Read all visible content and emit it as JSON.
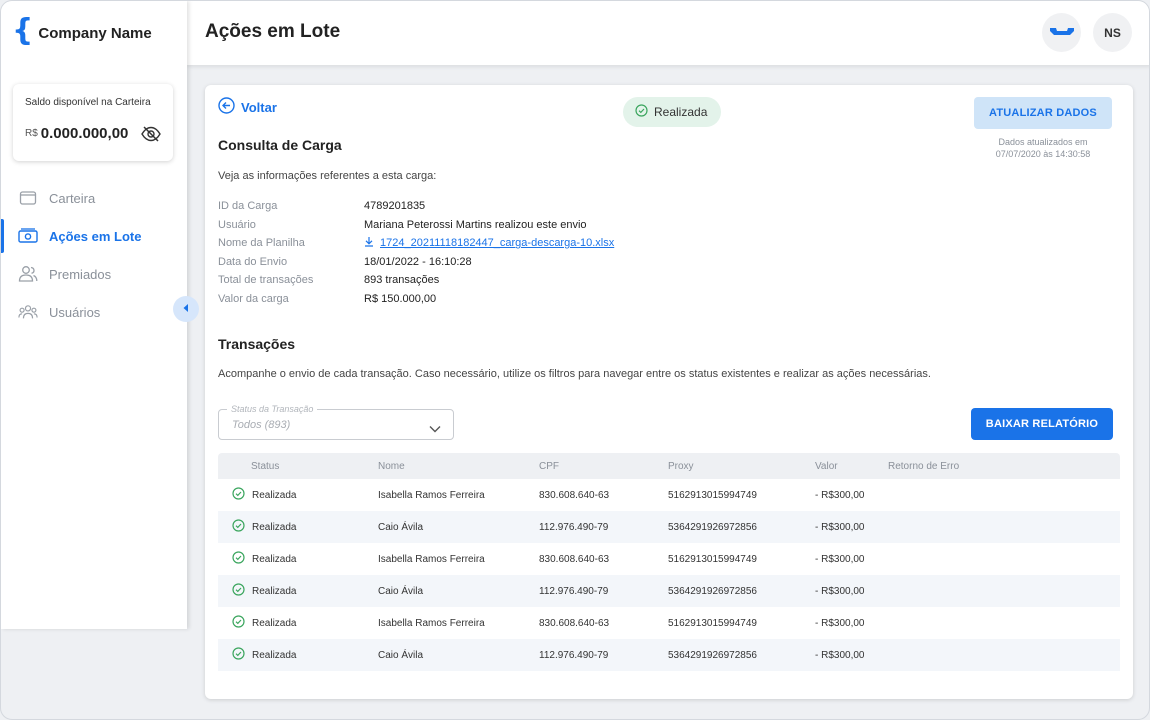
{
  "app": {
    "company_name": "Company Name"
  },
  "balance": {
    "label": "Saldo disponível na Carteira",
    "currency": "R$",
    "value": "0.000.000,00"
  },
  "sidebar": {
    "items": [
      {
        "label": "Carteira",
        "icon": "wallet-icon",
        "active": false
      },
      {
        "label": "Ações em Lote",
        "icon": "batch-money-icon",
        "active": true
      },
      {
        "label": "Premiados",
        "icon": "users-icon",
        "active": false
      },
      {
        "label": "Usuários",
        "icon": "group-icon",
        "active": false
      }
    ]
  },
  "header": {
    "title": "Ações em Lote",
    "avatar_initials": "NS"
  },
  "card": {
    "back_label": "Voltar",
    "status_label": "Realizada",
    "update_button": "ATUALIZAR DADOS",
    "updated_note_line1": "Dados atualizados em",
    "updated_note_line2": "07/07/2020 às 14:30:58",
    "title": "Consulta de Carga",
    "intro": "Veja as informações referentes a esta carga:",
    "info": [
      {
        "label": "ID da Carga",
        "value": "4789201835"
      },
      {
        "label": "Usuário",
        "value": "Mariana Peterossi Martins realizou este envio"
      },
      {
        "label": "Nome da Planilha",
        "value": "1724_20211118182447_carga-descarga-10.xlsx"
      },
      {
        "label": "Data do Envio",
        "value": "18/01/2022 - 16:10:28"
      },
      {
        "label": "Total de transações",
        "value": "893 transações"
      },
      {
        "label": "Valor da carga",
        "value": "R$ 150.000,00"
      }
    ],
    "transactions_title": "Transações",
    "transactions_desc": "Acompanhe o envio de cada transação. Caso necessário, utilize os filtros para navegar entre os status existentes e realizar as ações necessárias.",
    "filter": {
      "label": "Status da Transação",
      "value": "Todos (893)"
    },
    "report_button": "BAIXAR RELATÓRIO"
  },
  "table": {
    "columns": [
      "Status",
      "Nome",
      "CPF",
      "Proxy",
      "Valor",
      "Retorno de Erro"
    ],
    "rows": [
      [
        "Realizada",
        "Isabella Ramos Ferreira",
        "830.608.640-63",
        "5162913015994749",
        "- R$300,00",
        ""
      ],
      [
        "Realizada",
        "Caio Ávila",
        "112.976.490-79",
        "5364291926972856",
        "- R$300,00",
        ""
      ],
      [
        "Realizada",
        "Isabella Ramos Ferreira",
        "830.608.640-63",
        "5162913015994749",
        "- R$300,00",
        ""
      ],
      [
        "Realizada",
        "Caio Ávila",
        "112.976.490-79",
        "5364291926972856",
        "- R$300,00",
        ""
      ],
      [
        "Realizada",
        "Isabella Ramos Ferreira",
        "830.608.640-63",
        "5162913015994749",
        "- R$300,00",
        ""
      ],
      [
        "Realizada",
        "Caio Ávila",
        "112.976.490-79",
        "5364291926972856",
        "- R$300,00",
        ""
      ]
    ]
  },
  "colors": {
    "accent": "#1a73e8",
    "success": "#3aa55d",
    "muted": "#8a9099"
  }
}
